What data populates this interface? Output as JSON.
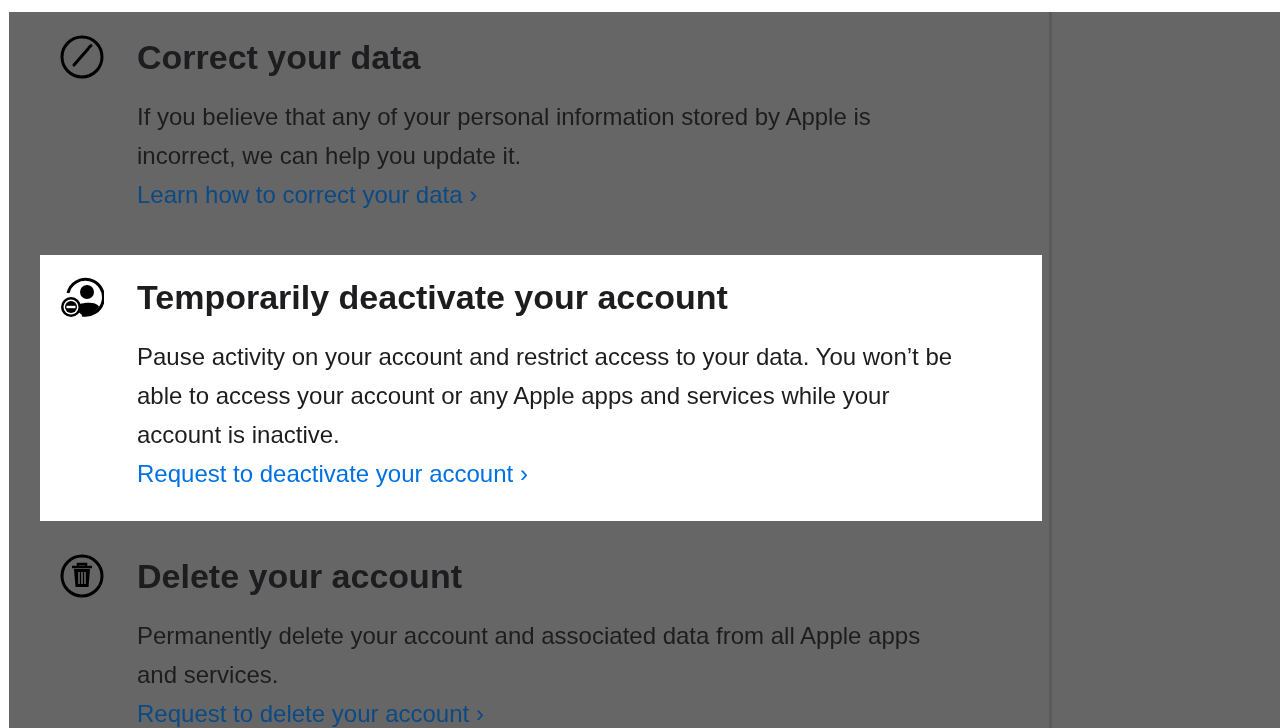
{
  "sections": [
    {
      "kind": "pencil",
      "title": "Correct your data",
      "body": "If you believe that any of your personal information stored by Apple is incorrect, we can help you update it.",
      "link": "Learn how to correct your data ›",
      "highlighted": false
    },
    {
      "kind": "person-minus",
      "title": "Temporarily deactivate your account",
      "body": "Pause activity on your account and restrict access to your data. You won’t be able to access your account or any Apple apps and services while your account is inactive.",
      "link": "Request to deactivate your account ›",
      "highlighted": true
    },
    {
      "kind": "trash",
      "title": "Delete your account",
      "body": "Permanently delete your account and associated data from all Apple apps and services.",
      "link": "Request to delete your account ›",
      "highlighted": false
    }
  ]
}
